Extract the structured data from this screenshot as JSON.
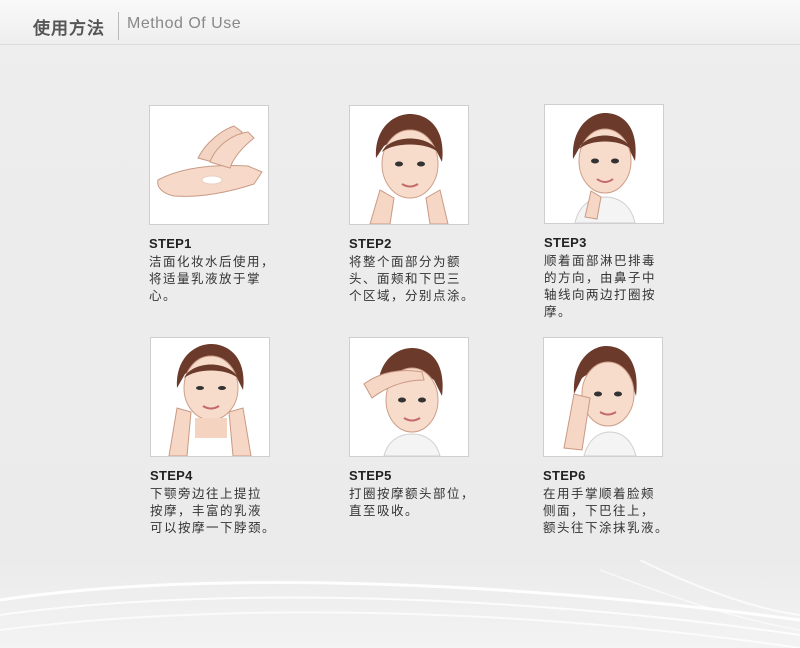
{
  "header": {
    "title_cn": "使用方法",
    "title_en": "Method Of Use"
  },
  "steps": [
    {
      "title": "STEP1",
      "text": "洁面化妆水后使用，\n将适量乳液放于掌\n心。"
    },
    {
      "title": "STEP2",
      "text": "将整个面部分为额\n头、面颊和下巴三\n个区域，分别点涂。"
    },
    {
      "title": "STEP3",
      "text": "顺着面部淋巴排毒\n的方向，由鼻子中\n轴线向两边打圈按\n摩。"
    },
    {
      "title": "STEP4",
      "text": "下颚旁边往上提拉\n按摩，丰富的乳液\n可以按摩一下脖颈。"
    },
    {
      "title": "STEP5",
      "text": "打圈按摩额头部位，\n直至吸收。"
    },
    {
      "title": "STEP6",
      "text": "在用手掌顺着脸颊\n侧面，下巴往上，\n额头往下涂抹乳液。"
    }
  ]
}
